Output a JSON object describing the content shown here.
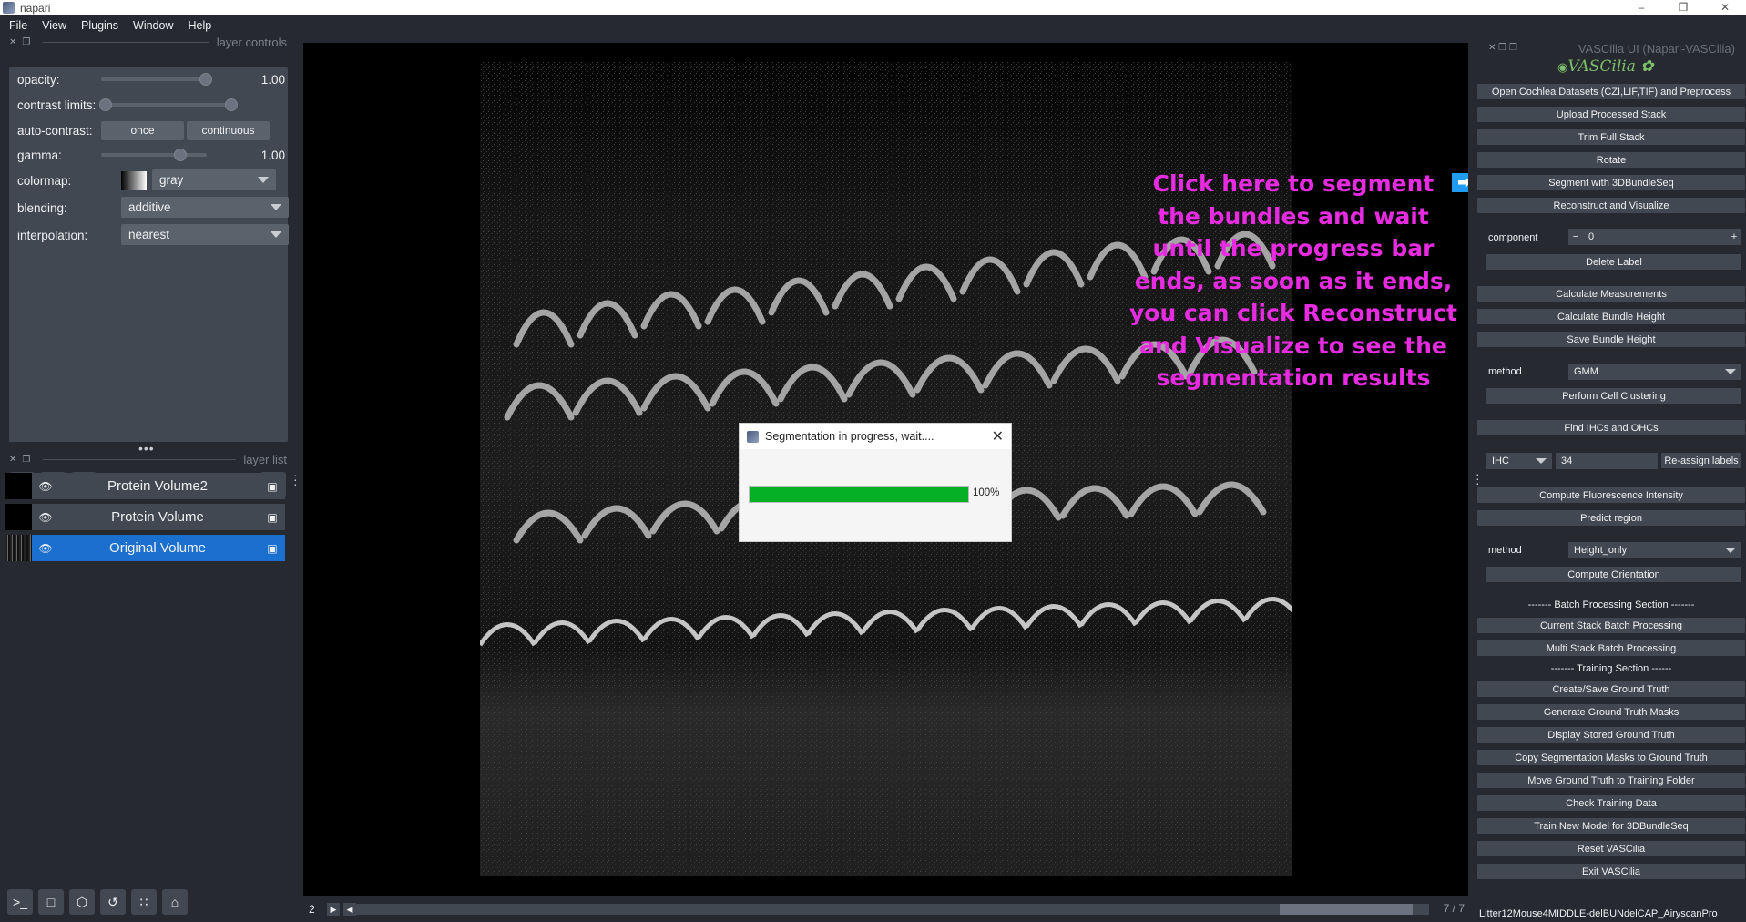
{
  "window": {
    "title": "napari",
    "controls": [
      "–",
      "❒",
      "✕"
    ]
  },
  "menu": [
    "File",
    "View",
    "Plugins",
    "Window",
    "Help"
  ],
  "layer_controls": {
    "title": "layer controls",
    "opacity": {
      "label": "opacity:",
      "value": "1.00",
      "fraction": 1.0
    },
    "contrast_limits": {
      "label": "contrast limits:"
    },
    "auto_contrast": {
      "label": "auto-contrast:",
      "once": "once",
      "continuous": "continuous"
    },
    "gamma": {
      "label": "gamma:",
      "value": "1.00"
    },
    "colormap": {
      "label": "colormap:",
      "value": "gray"
    },
    "blending": {
      "label": "blending:",
      "value": "additive"
    },
    "interpolation": {
      "label": "interpolation:",
      "value": "nearest"
    }
  },
  "layer_list": {
    "title": "layer list",
    "layers": [
      "Protein Volume2",
      "Protein Volume",
      "Original Volume"
    ]
  },
  "annotation": "Click here to segment the bundles and wait until the progress bar ends, as soon as it ends, you can click Reconstruct and Visualize to see the segmentation results",
  "arrow": "➡",
  "dialog": {
    "title": "Segmentation in progress, wait....",
    "progress": 1.0,
    "progress_label": "100%"
  },
  "dims": {
    "current": "2",
    "frame_a": "7",
    "frame_b": "7"
  },
  "plugin": {
    "title": "VASCilia UI (Napari-VASCilia)",
    "logo": "VASCilia",
    "buttons": {
      "open": "Open Cochlea Datasets (CZI,LIF,TIF) and Preprocess",
      "upload": "Upload Processed Stack",
      "trim": "Trim Full Stack",
      "rotate": "Rotate",
      "segment": "Segment with 3DBundleSeq",
      "reconstruct": "Reconstruct and Visualize",
      "delete_label": "Delete Label",
      "calc_measure": "Calculate Measurements",
      "calc_height": "Calculate Bundle Height",
      "save_height": "Save Bundle Height",
      "cluster": "Perform Cell Clustering",
      "find_ihc": "Find IHCs and OHCs",
      "reassign": "Re-assign labels",
      "fluor": "Compute Fluorescence Intensity",
      "predict": "Predict region",
      "orientation": "Compute Orientation",
      "current_batch": "Current Stack Batch Processing",
      "multi_batch": "Multi Stack Batch Processing",
      "create_gt": "Create/Save Ground Truth",
      "gen_masks": "Generate Ground Truth Masks",
      "display_gt": "Display Stored Ground Truth",
      "copy_masks": "Copy Segmentation Masks to Ground Truth",
      "move_gt": "Move Ground Truth to Training Folder",
      "check_train": "Check Training Data",
      "train_new": "Train New Model for 3DBundleSeq",
      "reset": "Reset VASCilia",
      "exit": "Exit VASCilia"
    },
    "component": {
      "label": "component",
      "minus": "−",
      "value": "0",
      "plus": "+"
    },
    "method1": {
      "label": "method",
      "value": "GMM"
    },
    "cell_type": "IHC",
    "cell_value": "34",
    "method2": {
      "label": "method",
      "value": "Height_only"
    },
    "batch_section": "------- Batch Processing Section -------",
    "training_section": "------- Training Section ------"
  },
  "status": "Litter12Mouse4MIDDLE-delBUNdelCAP_AiryscanPro"
}
